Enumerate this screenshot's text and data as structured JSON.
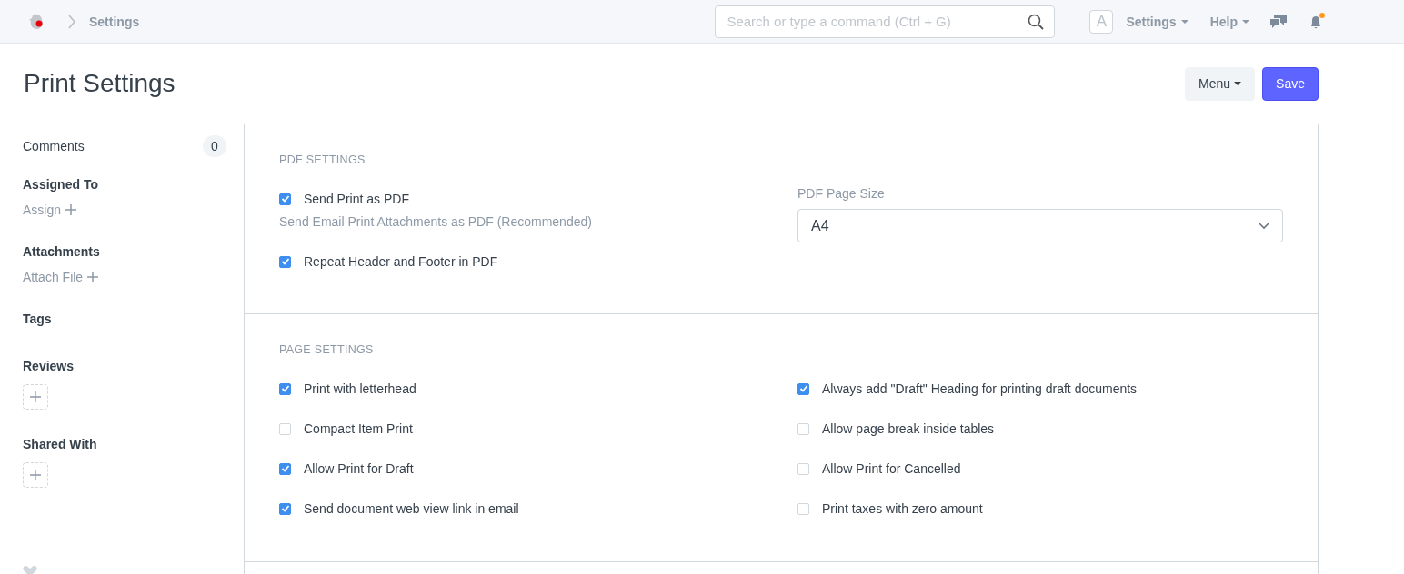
{
  "navbar": {
    "breadcrumb": "Settings",
    "search": {
      "placeholder": "Search or type a command (Ctrl + G)"
    },
    "avatar": "A",
    "menus": [
      "Settings",
      "Help"
    ],
    "notification_dot": true
  },
  "page": {
    "title": "Print Settings",
    "buttons": [
      {
        "label": "Menu",
        "kind": "dropdown"
      },
      {
        "label": "Save",
        "kind": "primary"
      }
    ]
  },
  "sidebar": {
    "comments": {
      "label": "Comments",
      "count": "0"
    },
    "sections": [
      {
        "title": "Assigned To",
        "kind": "link",
        "action": "Assign"
      },
      {
        "title": "Attachments",
        "kind": "link",
        "action": "Attach File"
      },
      {
        "title": "Tags",
        "kind": "empty"
      },
      {
        "title": "Reviews",
        "kind": "add-box"
      },
      {
        "title": "Shared With",
        "kind": "add-box"
      }
    ]
  },
  "sections": [
    {
      "title": "PDF SETTINGS",
      "columns": [
        [
          {
            "kind": "checkbox",
            "label": "Send Print as PDF",
            "checked": true,
            "description": "Send Email Print Attachments as PDF (Recommended)"
          },
          {
            "kind": "checkbox",
            "label": "Repeat Header and Footer in PDF",
            "checked": true
          }
        ],
        [
          {
            "kind": "select",
            "label": "PDF Page Size",
            "value": "A4"
          }
        ]
      ]
    },
    {
      "title": "PAGE SETTINGS",
      "columns": [
        [
          {
            "kind": "checkbox",
            "label": "Print with letterhead",
            "checked": true
          },
          {
            "kind": "checkbox",
            "label": "Compact Item Print",
            "checked": false
          },
          {
            "kind": "checkbox",
            "label": "Allow Print for Draft",
            "checked": true
          },
          {
            "kind": "checkbox",
            "label": "Send document web view link in email",
            "checked": true
          }
        ],
        [
          {
            "kind": "checkbox",
            "label": "Always add \"Draft\" Heading for printing draft documents",
            "checked": true
          },
          {
            "kind": "checkbox",
            "label": "Allow page break inside tables",
            "checked": false
          },
          {
            "kind": "checkbox",
            "label": "Allow Print for Cancelled",
            "checked": false
          },
          {
            "kind": "checkbox",
            "label": "Print taxes with zero amount",
            "checked": false
          }
        ]
      ]
    }
  ]
}
